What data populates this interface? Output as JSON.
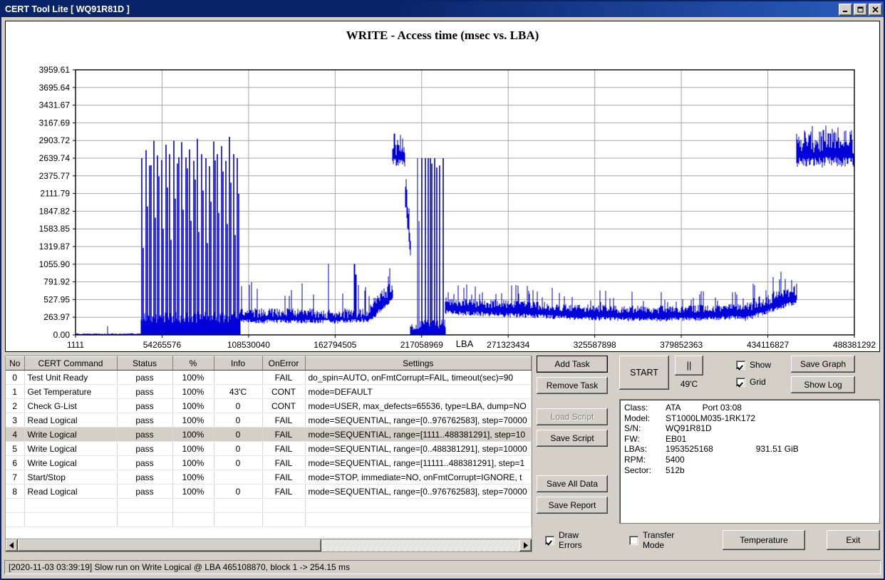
{
  "window": {
    "title": "CERT Tool Lite [ WQ91R81D ]",
    "minimize_label": "minimize",
    "maximize_label": "maximize",
    "close_label": "close"
  },
  "chart_data": {
    "type": "line",
    "title": "WRITE - Access time (msec vs. LBA)",
    "xlabel": "LBA",
    "ylabel": "",
    "grid": true,
    "line_color": "#0000d8",
    "ylim": [
      0,
      3959.61
    ],
    "xlim": [
      1111,
      488381292
    ],
    "ytick_labels": [
      "3959.61",
      "3695.64",
      "3431.67",
      "3167.69",
      "2903.72",
      "2639.74",
      "2375.77",
      "2111.79",
      "1847.82",
      "1583.85",
      "1319.87",
      "1055.90",
      "791.92",
      "527.95",
      "263.97",
      "0.00"
    ],
    "ytick_values": [
      3959.61,
      3695.64,
      3431.67,
      3167.69,
      2903.72,
      2639.74,
      2375.77,
      2111.79,
      1847.82,
      1583.85,
      1319.87,
      1055.9,
      791.92,
      527.95,
      263.97,
      0.0
    ],
    "xtick_labels": [
      "1111",
      "54265576",
      "108530040",
      "162794505",
      "217058969",
      "271323434",
      "325587898",
      "379852363",
      "434116827",
      "488381292"
    ],
    "xtick_values": [
      1111,
      54265576,
      108530040,
      162794505,
      217058969,
      271323434,
      325587898,
      379852363,
      434116827,
      488381292
    ],
    "series": [
      {
        "name": "Write access time",
        "description": "Scatter/needle trace of write access time in msec across the LBA range; baseline near 0-90 ms with dense spike clusters",
        "segments": [
          {
            "x_start": 1111,
            "x_end": 41000000,
            "baseline_ms": 10,
            "noise_ms": 8,
            "spikes": "sparse, one ~120 ms at LBA ~21000000"
          },
          {
            "x_start": 41000000,
            "x_end": 103000000,
            "baseline_ms": 260,
            "noise_ms": 70,
            "spikes": "regular full-height bursts to ~2640-2900 ms, ~24 spike columns"
          },
          {
            "x_start": 103000000,
            "x_end": 150000000,
            "baseline_ms": 300,
            "noise_ms": 90,
            "spikes": "occasional to ~800 ms"
          },
          {
            "x_start": 150000000,
            "x_end": 166000000,
            "baseline_ms": 280,
            "noise_ms": 80,
            "spikes": "one ~1060 ms column at ~158000000"
          },
          {
            "x_start": 166000000,
            "x_end": 184000000,
            "baseline_ms": 300,
            "noise_ms": 90,
            "spikes": "cluster to ~1000 ms at ~176000000"
          },
          {
            "x_start": 184000000,
            "x_end": 199000000,
            "baseline_ms": 430,
            "noise_ms": 130,
            "spikes": "rising ramp to ~800 ms"
          },
          {
            "x_start": 199000000,
            "x_end": 210000000,
            "baseline_ms": 2640,
            "noise_ms": 180,
            "spikes": "plateau ~2600-2900 ms"
          },
          {
            "x_start": 210000000,
            "x_end": 216000000,
            "baseline_ms": 60,
            "noise_ms": 40,
            "spikes": "drop to floor"
          },
          {
            "x_start": 216000000,
            "x_end": 232000000,
            "baseline_ms": 120,
            "noise_ms": 90,
            "spikes": "tall narrow bursts to ~2640 ms, ~8 columns"
          },
          {
            "x_start": 232000000,
            "x_end": 300000000,
            "baseline_ms": 420,
            "noise_ms": 120,
            "spikes": "frequent to ~700 ms"
          },
          {
            "x_start": 300000000,
            "x_end": 420000000,
            "baseline_ms": 330,
            "noise_ms": 110,
            "spikes": "frequent to ~640 ms"
          },
          {
            "x_start": 420000000,
            "x_end": 452000000,
            "baseline_ms": 420,
            "noise_ms": 140,
            "spikes": "rising ramp to ~800 ms"
          },
          {
            "x_start": 452000000,
            "x_end": 488381292,
            "baseline_ms": 2700,
            "noise_ms": 180,
            "spikes": "high plateau ~2450-2980 ms"
          }
        ]
      }
    ]
  },
  "task_table": {
    "columns": [
      "No",
      "CERT Command",
      "Status",
      "%",
      "Info",
      "OnError",
      "Settings"
    ],
    "selected_row_index": 4,
    "rows": [
      {
        "no": "0",
        "command": "Test Unit Ready",
        "status": "pass",
        "pct": "100%",
        "info": "",
        "onerror": "FAIL",
        "settings": "do_spin=AUTO, onFmtCorrupt=FAIL, timeout(sec)=90"
      },
      {
        "no": "1",
        "command": "Get Temperature",
        "status": "pass",
        "pct": "100%",
        "info": "43'C",
        "onerror": "CONT",
        "settings": "mode=DEFAULT"
      },
      {
        "no": "2",
        "command": "Check G-List",
        "status": "pass",
        "pct": "100%",
        "info": "0",
        "onerror": "CONT",
        "settings": "mode=USER, max_defects=65536, type=LBA, dump=NO"
      },
      {
        "no": "3",
        "command": "Read Logical",
        "status": "pass",
        "pct": "100%",
        "info": "0",
        "onerror": "FAIL",
        "settings": "mode=SEQUENTIAL, range=[0..976762583], step=70000"
      },
      {
        "no": "4",
        "command": "Write Logical",
        "status": "pass",
        "pct": "100%",
        "info": "0",
        "onerror": "FAIL",
        "settings": "mode=SEQUENTIAL, range=[1111..488381291], step=10"
      },
      {
        "no": "5",
        "command": "Write Logical",
        "status": "pass",
        "pct": "100%",
        "info": "0",
        "onerror": "FAIL",
        "settings": "mode=SEQUENTIAL, range=[0..488381291], step=10000"
      },
      {
        "no": "6",
        "command": "Write Logical",
        "status": "pass",
        "pct": "100%",
        "info": "0",
        "onerror": "FAIL",
        "settings": "mode=SEQUENTIAL, range=[11111..488381291], step=1"
      },
      {
        "no": "7",
        "command": "Start/Stop",
        "status": "pass",
        "pct": "100%",
        "info": "",
        "onerror": "FAIL",
        "settings": "mode=STOP, immediate=NO, onFmtCorrupt=IGNORE, t"
      },
      {
        "no": "8",
        "command": "Read Logical",
        "status": "pass",
        "pct": "100%",
        "info": "0",
        "onerror": "FAIL",
        "settings": "mode=SEQUENTIAL, range=[0..976762583], step=70000"
      }
    ]
  },
  "controls": {
    "add_task": "Add Task",
    "remove_task": "Remove Task",
    "load_script": "Load Script",
    "save_script": "Save Script",
    "save_all_data": "Save All Data",
    "save_report": "Save Report",
    "start": "START",
    "pause": "||",
    "temperature_value": "49'C",
    "show_label": "Show",
    "show_checked": true,
    "grid_label": "Grid",
    "grid_checked": true,
    "save_graph": "Save Graph",
    "show_log": "Show Log",
    "draw_errors_label": "Draw Errors",
    "draw_errors_checked": true,
    "transfer_mode_label": "Transfer Mode",
    "transfer_mode_checked": false,
    "temperature_button": "Temperature",
    "exit_button": "Exit"
  },
  "drive_info": {
    "class_key": "Class:",
    "class_value": "ATA",
    "port_value": "Port 03:08",
    "model_key": "Model:",
    "model_value": "ST1000LM035-1RK172",
    "sn_key": "S/N:",
    "sn_value": "WQ91R81D",
    "fw_key": "FW:",
    "fw_value": "EB01",
    "lbas_key": "LBAs:",
    "lbas_value": "1953525168",
    "capacity_value": "931.51 GiB",
    "rpm_key": "RPM:",
    "rpm_value": "5400",
    "sector_key": "Sector:",
    "sector_value": "512b"
  },
  "status_bar": {
    "message": "[2020-11-03 03:39:19] Slow run on Write Logical @ LBA 465108870, block 1 -> 254.15 ms"
  }
}
